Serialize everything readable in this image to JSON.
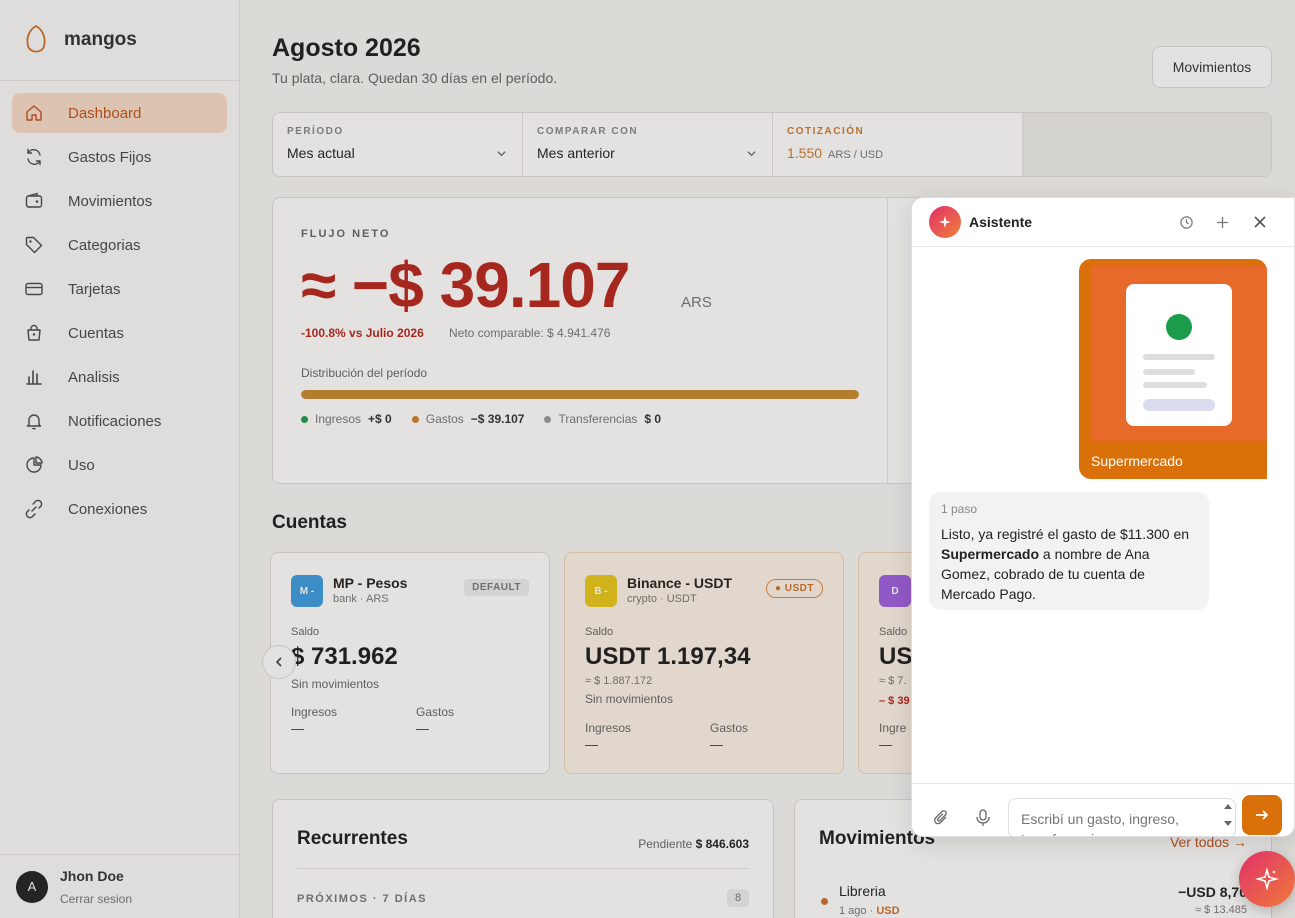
{
  "brand": {
    "name": "mangos"
  },
  "sidebar": {
    "items": [
      {
        "label": "Dashboard",
        "icon": "home-icon"
      },
      {
        "label": "Gastos Fijos",
        "icon": "refresh-icon"
      },
      {
        "label": "Movimientos",
        "icon": "wallet-icon"
      },
      {
        "label": "Categorias",
        "icon": "tag-icon"
      },
      {
        "label": "Tarjetas",
        "icon": "credit-card-icon"
      },
      {
        "label": "Cuentas",
        "icon": "bag-icon"
      },
      {
        "label": "Analisis",
        "icon": "bar-chart-icon"
      },
      {
        "label": "Notificaciones",
        "icon": "bell-icon"
      },
      {
        "label": "Uso",
        "icon": "pie-chart-icon"
      },
      {
        "label": "Conexiones",
        "icon": "link-icon"
      }
    ],
    "active_index": 0
  },
  "user": {
    "initial": "A",
    "name": "Jhon Doe",
    "logout": "Cerrar sesion"
  },
  "header": {
    "title": "Agosto 2026",
    "subtitle": "Tu plata, clara. Quedan 30 días en el período.",
    "movimientos_button": "Movimientos"
  },
  "filters": {
    "periodo": {
      "label": "PERÍODO",
      "value": "Mes actual"
    },
    "comparar": {
      "label": "COMPARAR CON",
      "value": "Mes anterior"
    },
    "cotizacion": {
      "label": "COTIZACIÓN",
      "value": "1.550",
      "unit": "ARS / USD"
    }
  },
  "flujo": {
    "label": "FLUJO NETO",
    "amount": "≈ −$ 39.107",
    "currency": "ARS",
    "vs": "-100.8% vs Julio 2026",
    "neto": "Neto comparable: $ 4.941.476",
    "dist_label": "Distribución del período",
    "gastos_fraction": 1.0,
    "legend": [
      {
        "name": "Ingresos",
        "value": "+$ 0",
        "color": "#1a9c4a"
      },
      {
        "name": "Gastos",
        "value": "−$ 39.107",
        "color": "#d0802a"
      },
      {
        "name": "Transferencias",
        "value": "$ 0",
        "color": "#999999"
      }
    ]
  },
  "cuentas": {
    "title": "Cuentas",
    "items": [
      {
        "badge": "M -",
        "badge_color": "#3d9be0",
        "name": "MP - Pesos",
        "sub": "bank · ARS",
        "tag": "DEFAULT",
        "saldo_label": "Saldo",
        "saldo": "$ 731.962",
        "approx": "",
        "neg": "",
        "movs": "Sin movimientos",
        "ingresos_label": "Ingresos",
        "ingresos": "—",
        "gastos_label": "Gastos",
        "gastos": "—"
      },
      {
        "badge": "B -",
        "badge_color": "#e8c81a",
        "name": "Binance - USDT",
        "sub": "crypto · USDT",
        "tag": "● USDT",
        "saldo_label": "Saldo",
        "saldo": "USDT 1.197,34",
        "approx": "≈ $ 1.887.172",
        "neg": "",
        "movs": "Sin movimientos",
        "ingresos_label": "Ingresos",
        "ingresos": "—",
        "gastos_label": "Gastos",
        "gastos": "—"
      },
      {
        "badge": "D",
        "badge_color": "#a060e0",
        "name": "",
        "sub": "",
        "tag": "",
        "saldo_label": "Saldo",
        "saldo": "US",
        "approx": "≈ $ 7.",
        "neg": "– $ 39",
        "movs": "",
        "ingresos_label": "Ingre",
        "ingresos": "—",
        "gastos_label": "",
        "gastos": ""
      }
    ]
  },
  "recurrentes": {
    "title": "Recurrentes",
    "pendiente_label": "Pendiente",
    "pendiente_value": "$ 846.603",
    "proximos": "PRÓXIMOS · 7 DÍAS",
    "count": "8"
  },
  "movimientos": {
    "title": "Movimientos",
    "link": "Ver todos →",
    "items": [
      {
        "name": "Libreria",
        "meta": "1 ago · ",
        "meta_tag": "USD",
        "amount": "−USD 8,70",
        "amount_ars": "≈ $ 13.485"
      }
    ]
  },
  "assistant": {
    "title": "Asistente",
    "user_message": "Supermercado",
    "bot_step": "1 paso",
    "bot_text_before": "Listo, ya registré el gasto de $11.300 en ",
    "bot_text_bold": "Supermercado",
    "bot_text_after": " a nombre de Ana Gomez, cobrado de tu cuenta de Mercado Pago.",
    "input_placeholder": "Escribí un gasto, ingreso, transferencia..."
  }
}
